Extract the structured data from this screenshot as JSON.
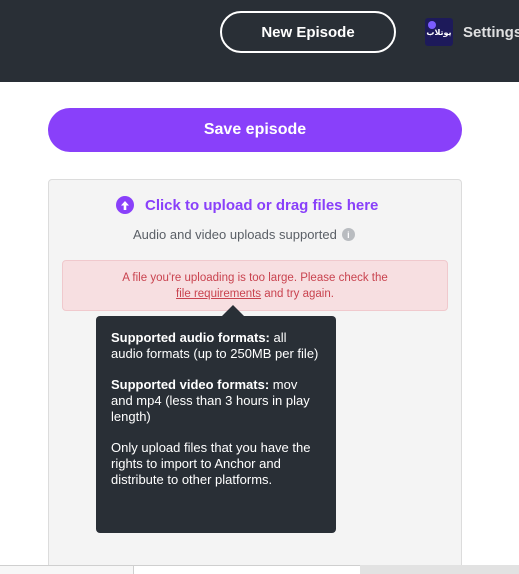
{
  "header": {
    "new_episode_label": "New Episode",
    "avatar_text": "يوتلاب",
    "settings_label": "Settings"
  },
  "actions": {
    "save_label": "Save episode"
  },
  "upload": {
    "cta": "Click to upload or drag files here",
    "supported": "Audio and video uploads supported",
    "info_icon": "i"
  },
  "error": {
    "line1": "A file you're uploading is too large. Please check the",
    "link": "file requirements",
    "line2_suffix": " and try again."
  },
  "tooltip": {
    "audio_title": "Supported audio formats:",
    "audio_body": " all audio formats (up to 250MB per file)",
    "video_title": "Supported video formats:",
    "video_body": " mov and mp4 (less than 3 hours in play length)",
    "rights": "Only upload files that you have the rights to import to Anchor and distribute to other platforms."
  },
  "colors": {
    "brand": "#8940fa",
    "header_bg": "#292f36",
    "error_text": "#c9434f",
    "error_bg": "#f7dfe1"
  },
  "icons": [
    "upload-arrow-icon",
    "info-icon",
    "podcast-avatar"
  ]
}
